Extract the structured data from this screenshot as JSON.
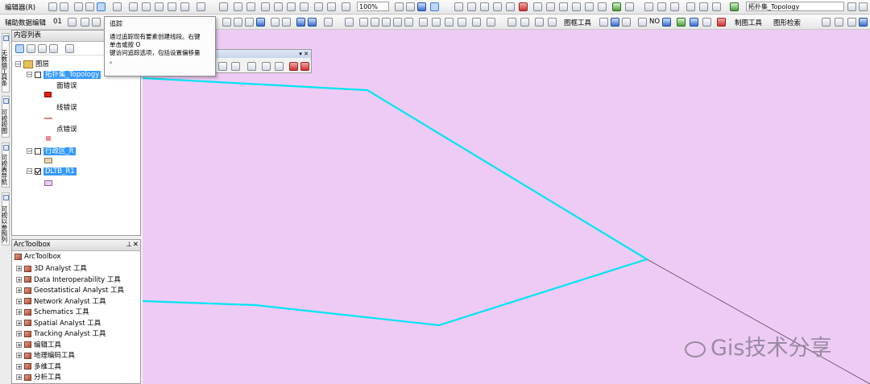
{
  "toolbar1": {
    "editor_menu": "编辑器(R)",
    "zoom_value": "100%",
    "topology_combo": "拓扑集_Topology"
  },
  "toolbar2": {
    "aux_edit": "辅助数据编辑",
    "aux_value": "01",
    "frame_tools": "图框工具",
    "no_label": "NO",
    "drawing_tools": "制图工具",
    "graphic_query": "图形检索"
  },
  "tooltip": {
    "title": "追踪",
    "lines": [
      "通过追踪现有要素创建线段。右键",
      "单击或按 O",
      "键访问追踪选项，包括设置偏移量",
      "。"
    ]
  },
  "toc": {
    "title": "内容列表",
    "root": "图层",
    "layers": [
      {
        "name": "拓扑集_Topology",
        "checked": false,
        "items": [
          "面错误",
          "线错误",
          "点错误"
        ]
      },
      {
        "name": "行政区_R",
        "checked": false
      },
      {
        "name": "DLTB_R1",
        "checked": true
      }
    ]
  },
  "side_tabs": [
    "无数值工具条",
    "可视视图",
    "可视表导航",
    "可视以参照列表"
  ],
  "arctoolbox": {
    "title": "ArcToolbox",
    "root": "ArcToolbox",
    "items": [
      "3D Analyst 工具",
      "Data Interoperability 工具",
      "Geostatistical Analyst 工具",
      "Network Analyst 工具",
      "Schematics 工具",
      "Spatial Analyst 工具",
      "Tracking Analyst 工具",
      "编辑工具",
      "地理编码工具",
      "多维工具",
      "分析工具"
    ]
  },
  "watermark": "Gis技术分享",
  "colors": {
    "map_bg": "#eecbf4",
    "trace_line": "#00e5f5",
    "highlight": "#3399ff"
  }
}
